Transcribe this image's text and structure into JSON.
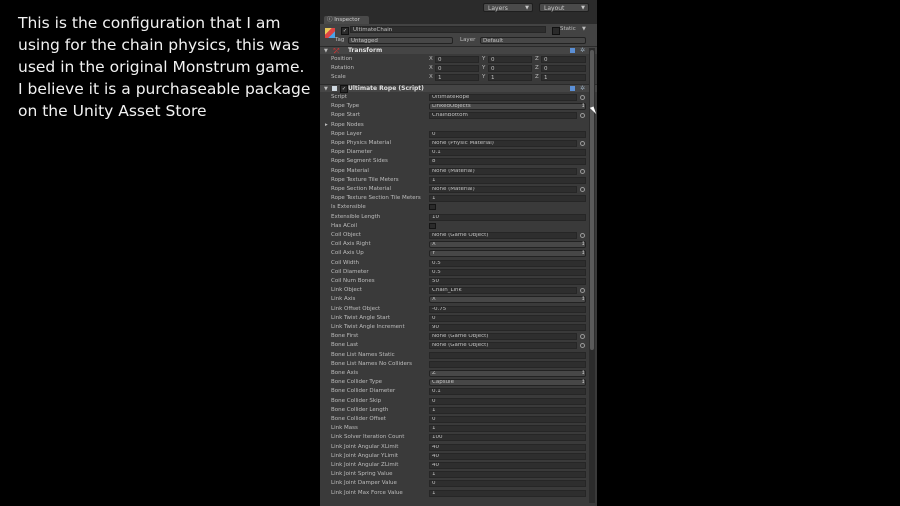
{
  "caption": {
    "lines": [
      "This is the configuration that I am",
      "using for the chain physics, this was",
      "used in the original Monstrum game.",
      "I believe it is a purchaseable package",
      "on the Unity Asset Store"
    ]
  },
  "topbar": {
    "layers": "Layers",
    "layout": "Layout"
  },
  "tab": {
    "label": "Inspector"
  },
  "gameobject": {
    "name": "UltimateChain",
    "static_label": "Static",
    "tag_label": "Tag",
    "tag_value": "Untagged",
    "layer_label": "Layer",
    "layer_value": "Default"
  },
  "transform": {
    "title": "Transform",
    "position_label": "Position",
    "rotation_label": "Rotation",
    "scale_label": "Scale",
    "axis_x": "X",
    "axis_y": "Y",
    "axis_z": "Z",
    "position": [
      "0",
      "0",
      "0"
    ],
    "rotation": [
      "0",
      "0",
      "0"
    ],
    "scale": [
      "1",
      "1",
      "1"
    ]
  },
  "script_component": {
    "title": "Ultimate Rope (Script)"
  },
  "properties": [
    {
      "name": "Script",
      "value": "UltimateRope",
      "kind": "obj"
    },
    {
      "name": "Rope Type",
      "value": "LinkedObjects",
      "kind": "enum"
    },
    {
      "name": "Rope Start",
      "value": "ChainBottom",
      "kind": "obj"
    },
    {
      "name": "Rope Nodes",
      "value": "",
      "kind": "foldout"
    },
    {
      "name": "Rope Layer",
      "value": "0",
      "kind": "num"
    },
    {
      "name": "Rope Physics Material",
      "value": "None (Physic Material)",
      "kind": "obj"
    },
    {
      "name": "Rope Diameter",
      "value": "0.1",
      "kind": "num"
    },
    {
      "name": "Rope Segment Sides",
      "value": "8",
      "kind": "num"
    },
    {
      "name": "Rope Material",
      "value": "None (Material)",
      "kind": "obj"
    },
    {
      "name": "Rope Texture Tile Meters",
      "value": "1",
      "kind": "num"
    },
    {
      "name": "Rope Section Material",
      "value": "None (Material)",
      "kind": "obj"
    },
    {
      "name": "Rope Texture Section Tile Meters",
      "value": "1",
      "kind": "num"
    },
    {
      "name": "Is Extensible",
      "value": "",
      "kind": "bool"
    },
    {
      "name": "Extensible Length",
      "value": "10",
      "kind": "num"
    },
    {
      "name": "Has ACoil",
      "value": "",
      "kind": "bool"
    },
    {
      "name": "Coil Object",
      "value": "None (Game Object)",
      "kind": "obj"
    },
    {
      "name": "Coil Axis Right",
      "value": "X",
      "kind": "enum"
    },
    {
      "name": "Coil Axis Up",
      "value": "Y",
      "kind": "enum"
    },
    {
      "name": "Coil Width",
      "value": "0.5",
      "kind": "num"
    },
    {
      "name": "Coil Diameter",
      "value": "0.5",
      "kind": "num"
    },
    {
      "name": "Coil Num Bones",
      "value": "50",
      "kind": "num"
    },
    {
      "name": "Link Object",
      "value": "Chain_Link",
      "kind": "obj"
    },
    {
      "name": "Link Axis",
      "value": "X",
      "kind": "enum"
    },
    {
      "name": "Link Offset Object",
      "value": "-0.75",
      "kind": "num"
    },
    {
      "name": "Link Twist Angle Start",
      "value": "0",
      "kind": "num"
    },
    {
      "name": "Link Twist Angle Increment",
      "value": "90",
      "kind": "num"
    },
    {
      "name": "Bone First",
      "value": "None (Game Object)",
      "kind": "obj"
    },
    {
      "name": "Bone Last",
      "value": "None (Game Object)",
      "kind": "obj"
    },
    {
      "name": "Bone List Names Static",
      "value": "",
      "kind": "num"
    },
    {
      "name": "Bone List Names No Colliders",
      "value": "",
      "kind": "num"
    },
    {
      "name": "Bone Axis",
      "value": "Z",
      "kind": "enum"
    },
    {
      "name": "Bone Collider Type",
      "value": "Capsule",
      "kind": "enum"
    },
    {
      "name": "Bone Collider Diameter",
      "value": "0.1",
      "kind": "num"
    },
    {
      "name": "Bone Collider Skip",
      "value": "0",
      "kind": "num"
    },
    {
      "name": "Bone Collider Length",
      "value": "1",
      "kind": "num"
    },
    {
      "name": "Bone Collider Offset",
      "value": "0",
      "kind": "num"
    },
    {
      "name": "Link Mass",
      "value": "1",
      "kind": "num"
    },
    {
      "name": "Link Solver Iteration Count",
      "value": "100",
      "kind": "num"
    },
    {
      "name": "Link Joint Angular XLimit",
      "value": "40",
      "kind": "num"
    },
    {
      "name": "Link Joint Angular YLimit",
      "value": "40",
      "kind": "num"
    },
    {
      "name": "Link Joint Angular ZLimit",
      "value": "40",
      "kind": "num"
    },
    {
      "name": "Link Joint Spring Value",
      "value": "1",
      "kind": "num"
    },
    {
      "name": "Link Joint Damper Value",
      "value": "0",
      "kind": "num"
    },
    {
      "name": "Link Joint Max Force Value",
      "value": "1",
      "kind": "num"
    }
  ]
}
